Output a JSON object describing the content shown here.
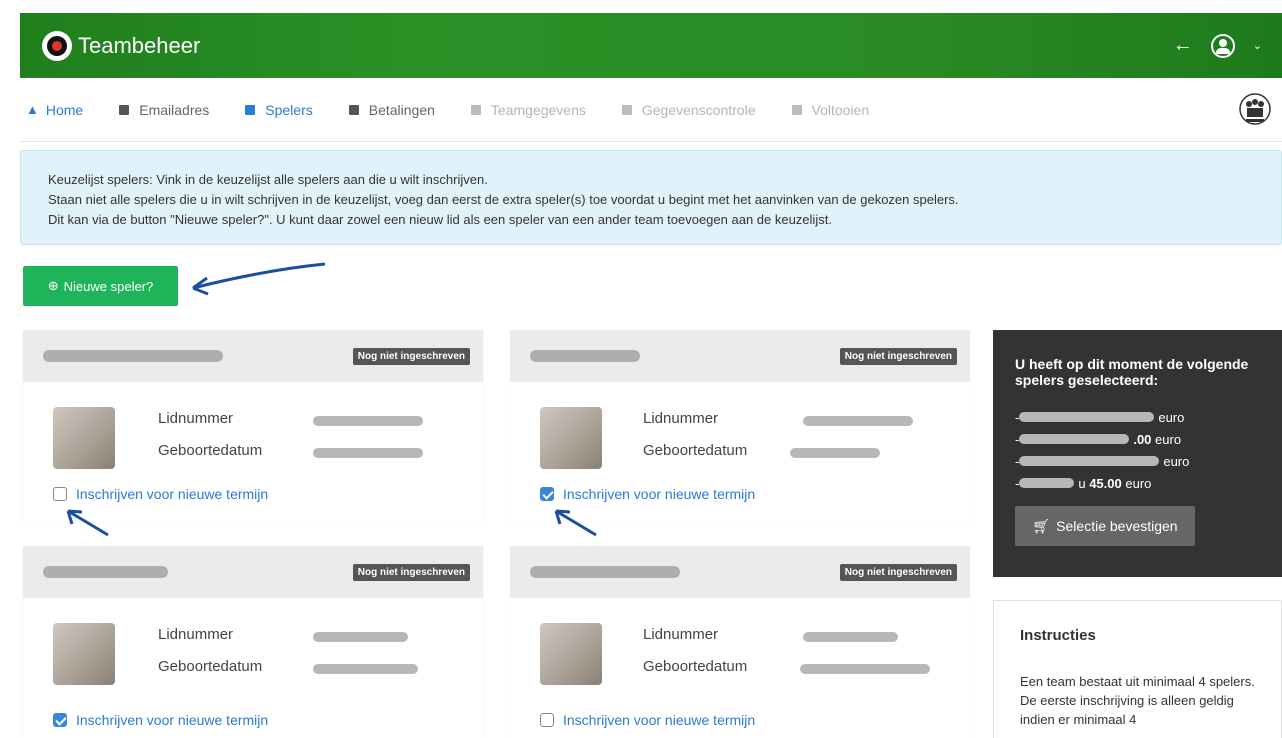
{
  "app": {
    "title": "Teambeheer"
  },
  "nav": {
    "items": [
      {
        "label": "Home"
      },
      {
        "label": "Emailadres"
      },
      {
        "label": "Spelers"
      },
      {
        "label": "Betalingen"
      },
      {
        "label": "Teamgegevens"
      },
      {
        "label": "Gegevenscontrole"
      },
      {
        "label": "Voltooien"
      }
    ]
  },
  "info": {
    "line1": "Keuzelijst spelers: Vink in de keuzelijst alle spelers aan die u wilt inschrijven.",
    "line2": "Staan niet alle spelers die u in wilt schrijven in de keuzelijst, voeg dan eerst de extra speler(s) toe voordat u begint met het aanvinken van de gekozen spelers.",
    "line3": "Dit kan via de button \"Nieuwe speler?\". U kunt daar zowel een nieuw lid als een speler van een ander team toevoegen aan de keuzelijst."
  },
  "new_player_button": "Nieuwe speler?",
  "players": [
    {
      "status": "Nog niet ingeschreven",
      "member_label": "Lidnummer",
      "birth_label": "Geboortedatum",
      "checkbox_label": "Inschrijven voor nieuwe termijn",
      "checked": false
    },
    {
      "status": "Nog niet ingeschreven",
      "member_label": "Lidnummer",
      "birth_label": "Geboortedatum",
      "checkbox_label": "Inschrijven voor nieuwe termijn",
      "checked": true
    },
    {
      "status": "Nog niet ingeschreven",
      "member_label": "Lidnummer",
      "birth_label": "Geboortedatum",
      "checkbox_label": "Inschrijven voor nieuwe termijn",
      "checked": true
    },
    {
      "status": "Nog niet ingeschreven",
      "member_label": "Lidnummer",
      "birth_label": "Geboortedatum",
      "checkbox_label": "Inschrijven voor nieuwe termijn",
      "checked": false
    }
  ],
  "selection": {
    "title": "U heeft op dit moment de volgende spelers geselecteerd:",
    "rows": [
      {
        "prefix": "-",
        "suffix": "euro",
        "bold": ""
      },
      {
        "prefix": "-",
        "suffix": "euro",
        "bold": ".00"
      },
      {
        "prefix": "-",
        "suffix": "euro",
        "bold": ""
      },
      {
        "prefix": "-",
        "suffix": "euro",
        "bold": "45.00"
      }
    ],
    "confirm_button": "Selectie bevestigen"
  },
  "instructions": {
    "title": "Instructies",
    "text": "Een team bestaat uit minimaal 4 spelers. De eerste inschrijving is alleen geldig indien er minimaal 4"
  },
  "colors": {
    "brand_green": "#2a8b24",
    "button_green": "#20b45a",
    "link_blue": "#2a7bd5",
    "dark_panel": "#333333"
  }
}
